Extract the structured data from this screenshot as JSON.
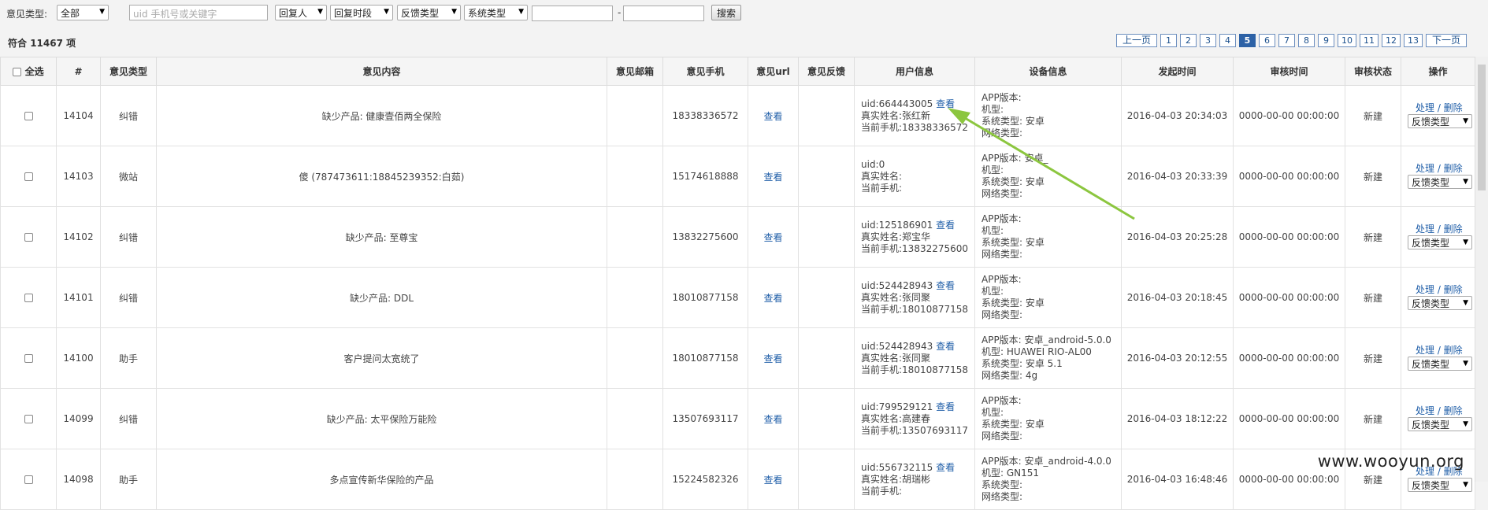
{
  "filters": {
    "type_label": "意见类型:",
    "type_value": "全部",
    "search_placeholder": "uid 手机号或关键字",
    "reply_person": "回复人",
    "reply_period": "回复时段",
    "feedback_type": "反馈类型",
    "system_type": "系统类型",
    "date_from": "",
    "date_to": "",
    "dash": "-",
    "search_button": "搜索"
  },
  "summary": {
    "prefix": "符合",
    "count": "11467",
    "suffix": "项"
  },
  "pagination": {
    "prev": "上一页",
    "pages": [
      "1",
      "2",
      "3",
      "4",
      "5",
      "6",
      "7",
      "8",
      "9",
      "10",
      "11",
      "12",
      "13"
    ],
    "current": "5",
    "next": "下一页"
  },
  "table": {
    "headers": {
      "select_all": "全选",
      "index": "#",
      "type": "意见类型",
      "content": "意见内容",
      "email": "意见邮箱",
      "phone": "意见手机",
      "url": "意见url",
      "feedback": "意见反馈",
      "user_info": "用户信息",
      "device_info": "设备信息",
      "created_at": "发起时间",
      "reviewed_at": "审核时间",
      "status": "审核状态",
      "ops": "操作"
    },
    "rows": [
      {
        "id": "14104",
        "type": "纠错",
        "content": "缺少产品: 健康壹佰两全保险",
        "email": "",
        "phone": "18338336572",
        "url": "查看",
        "uid": "uid:664443005",
        "uid_link": "查看",
        "name": "真实姓名:张红新",
        "cur_phone": "当前手机:18338336572",
        "app_version": "APP版本:",
        "model": "机型:",
        "os": "系统类型: 安卓",
        "network": "网络类型:",
        "created": "2016-04-03 20:34:03",
        "reviewed": "0000-00-00 00:00:00",
        "status": "新建",
        "action": "处理 / 删除",
        "select": "反馈类型"
      },
      {
        "id": "14103",
        "type": "微站",
        "content": "傻 (787473611:18845239352:白茹)",
        "email": "",
        "phone": "15174618888",
        "url": "查看",
        "uid": "uid:0",
        "uid_link": "",
        "name": "真实姓名:",
        "cur_phone": "当前手机:",
        "app_version": "APP版本: 安卓_",
        "model": "机型:",
        "os": "系统类型: 安卓",
        "network": "网络类型:",
        "created": "2016-04-03 20:33:39",
        "reviewed": "0000-00-00 00:00:00",
        "status": "新建",
        "action": "处理 / 删除",
        "select": "反馈类型"
      },
      {
        "id": "14102",
        "type": "纠错",
        "content": "缺少产品: 至尊宝",
        "email": "",
        "phone": "13832275600",
        "url": "查看",
        "uid": "uid:125186901",
        "uid_link": "查看",
        "name": "真实姓名:郑宝华",
        "cur_phone": "当前手机:13832275600",
        "app_version": "APP版本:",
        "model": "机型:",
        "os": "系统类型: 安卓",
        "network": "网络类型:",
        "created": "2016-04-03 20:25:28",
        "reviewed": "0000-00-00 00:00:00",
        "status": "新建",
        "action": "处理 / 删除",
        "select": "反馈类型"
      },
      {
        "id": "14101",
        "type": "纠错",
        "content": "缺少产品: DDL",
        "email": "",
        "phone": "18010877158",
        "url": "查看",
        "uid": "uid:524428943",
        "uid_link": "查看",
        "name": "真实姓名:张同聚",
        "cur_phone": "当前手机:18010877158",
        "app_version": "APP版本:",
        "model": "机型:",
        "os": "系统类型: 安卓",
        "network": "网络类型:",
        "created": "2016-04-03 20:18:45",
        "reviewed": "0000-00-00 00:00:00",
        "status": "新建",
        "action": "处理 / 删除",
        "select": "反馈类型"
      },
      {
        "id": "14100",
        "type": "助手",
        "content": "客户提问太宽统了",
        "email": "",
        "phone": "18010877158",
        "url": "查看",
        "uid": "uid:524428943",
        "uid_link": "查看",
        "name": "真实姓名:张同聚",
        "cur_phone": "当前手机:18010877158",
        "app_version": "APP版本: 安卓_android-5.0.0",
        "model": "机型: HUAWEI RIO-AL00",
        "os": "系统类型: 安卓 5.1",
        "network": "网络类型: 4g",
        "created": "2016-04-03 20:12:55",
        "reviewed": "0000-00-00 00:00:00",
        "status": "新建",
        "action": "处理 / 删除",
        "select": "反馈类型"
      },
      {
        "id": "14099",
        "type": "纠错",
        "content": "缺少产品: 太平保险万能险",
        "email": "",
        "phone": "13507693117",
        "url": "查看",
        "uid": "uid:799529121",
        "uid_link": "查看",
        "name": "真实姓名:高建春",
        "cur_phone": "当前手机:13507693117",
        "app_version": "APP版本:",
        "model": "机型:",
        "os": "系统类型: 安卓",
        "network": "网络类型:",
        "created": "2016-04-03 18:12:22",
        "reviewed": "0000-00-00 00:00:00",
        "status": "新建",
        "action": "处理 / 删除",
        "select": "反馈类型"
      },
      {
        "id": "14098",
        "type": "助手",
        "content": "多点宣传新华保险的产品",
        "email": "",
        "phone": "15224582326",
        "url": "查看",
        "uid": "uid:556732115",
        "uid_link": "查看",
        "name": "真实姓名:胡瑞彬",
        "cur_phone": "当前手机:",
        "app_version": "APP版本: 安卓_android-4.0.0",
        "model": "机型: GN151",
        "os": "系统类型:",
        "network": "网络类型:",
        "created": "2016-04-03 16:48:46",
        "reviewed": "0000-00-00 00:00:00",
        "status": "新建",
        "action": "处理 / 删除",
        "select": "反馈类型"
      }
    ]
  },
  "watermark": "www.wooyun.org",
  "colors": {
    "link": "#1f5ea8",
    "annotation_arrow": "#8cc63f",
    "active_page": "#2d62a6"
  }
}
